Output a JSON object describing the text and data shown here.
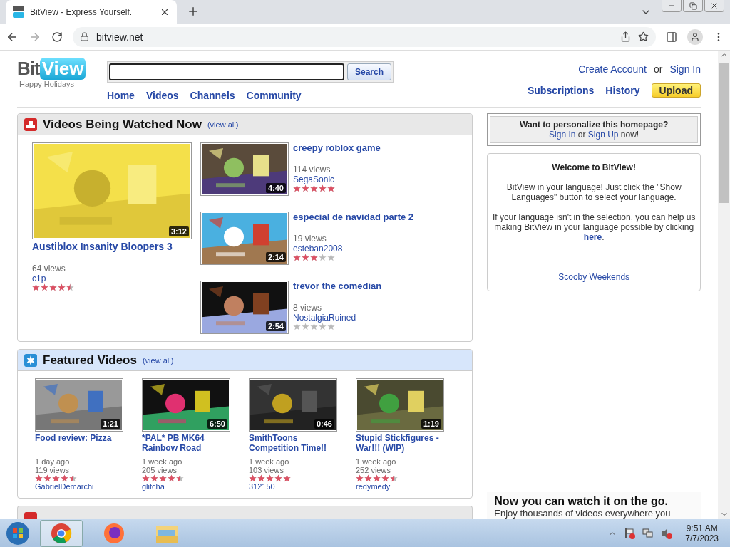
{
  "browser": {
    "tab_title": "BitView - Express Yourself.",
    "url": "bitview.net"
  },
  "site": {
    "logo_left": "Bit",
    "logo_right": "View",
    "tagline": "Happy Holidays",
    "search_button": "Search",
    "nav": [
      "Home",
      "Videos",
      "Channels",
      "Community"
    ],
    "account_links": [
      {
        "text": "Create Account",
        "link": true
      },
      {
        "text": "or",
        "link": false
      },
      {
        "text": "Sign In",
        "link": true
      }
    ],
    "user_links": [
      {
        "text": "Subscriptions",
        "kind": "link"
      },
      {
        "text": "History",
        "kind": "link"
      },
      {
        "text": "Upload",
        "kind": "button"
      }
    ]
  },
  "watched": {
    "title": "Videos Being Watched Now",
    "view_all": "(view all)",
    "main": {
      "title": "Austiblox Insanity Bloopers 3",
      "duration": "3:12",
      "views": "64 views",
      "user": "c1p",
      "stars": 4.5
    },
    "list": [
      {
        "title": "creepy roblox game",
        "duration": "4:40",
        "views": "114 views",
        "user": "SegaSonic",
        "stars": 5
      },
      {
        "title": "especial de navidad parte 2",
        "duration": "2:14",
        "views": "19 views",
        "user": "esteban2008",
        "stars": 3
      },
      {
        "title": "trevor the comedian",
        "duration": "2:54",
        "views": "8 views",
        "user": "NostalgiaRuined",
        "stars": 0
      }
    ]
  },
  "featured": {
    "title": "Featured Videos",
    "view_all": "(view all)",
    "videos": [
      {
        "title": "Food review: Pizza",
        "duration": "1:21",
        "age": "1 day ago",
        "views": "119 views",
        "stars": 4.5,
        "user": "GabrielDemarchi"
      },
      {
        "title": "*PAL* PB MK64 Rainbow Road",
        "duration": "6:50",
        "age": "1 week ago",
        "views": "205 views",
        "stars": 4.5,
        "user": "glitcha"
      },
      {
        "title": "SmithToons Competition Time!!",
        "duration": "0:46",
        "age": "1 week ago",
        "views": "103 views",
        "stars": 5,
        "user": "312150"
      },
      {
        "title": "Stupid Stickfigures - War!!! (WIP)",
        "duration": "1:19",
        "age": "1 week ago",
        "views": "252 views",
        "stars": 4.5,
        "user": "redymedy"
      }
    ]
  },
  "personalize": {
    "question": "Want to personalize this homepage?",
    "line": [
      {
        "text": "Sign In",
        "link": true
      },
      {
        "text": " or ",
        "link": false
      },
      {
        "text": "Sign Up",
        "link": true
      },
      {
        "text": " now!",
        "link": false
      }
    ]
  },
  "welcome": {
    "title": "Welcome to BitView!",
    "paragraphs": [
      [
        {
          "text": "BitView in your language! Just click the \"Show Languages\" button to select your language.",
          "link": false
        }
      ],
      [
        {
          "text": "If your language isn't in the selection, you can help us making BitView in your language possible by clicking ",
          "link": false
        },
        {
          "text": "here",
          "link": true
        },
        {
          "text": ".",
          "link": false
        }
      ]
    ],
    "footer_link": "Scooby Weekends"
  },
  "mobile_ad": {
    "headline": "Now you can watch it on the go.",
    "text": "Enjoy thousands of videos everywhere you"
  },
  "taskbar": {
    "time": "9:51 AM",
    "date": "7/7/2023"
  }
}
